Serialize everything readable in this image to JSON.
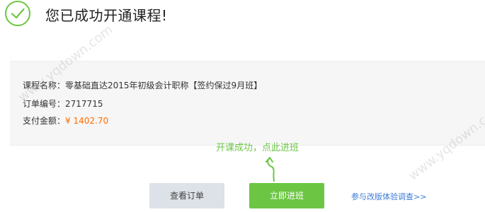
{
  "header": {
    "title": "您已成功开通课程!"
  },
  "info": {
    "course_label": "课程名称：",
    "course_name": "零基础直达2015年初级会计职称【签约保过9月班】",
    "order_label": "订单编号：",
    "order_number": "2717715",
    "amount_label": "支付金额：",
    "amount_value": "¥ 1402.70"
  },
  "hint": {
    "text": "开课成功，点此进班"
  },
  "actions": {
    "orders_label": "查看订单",
    "enter_label": "立即进班",
    "survey_label": "参与改版体验调查>>"
  },
  "watermark": {
    "text": "www.yqdown.com"
  },
  "colors": {
    "accent_green": "#6cc644",
    "amount_orange": "#ff6a00",
    "link_blue": "#3b7ad9"
  }
}
